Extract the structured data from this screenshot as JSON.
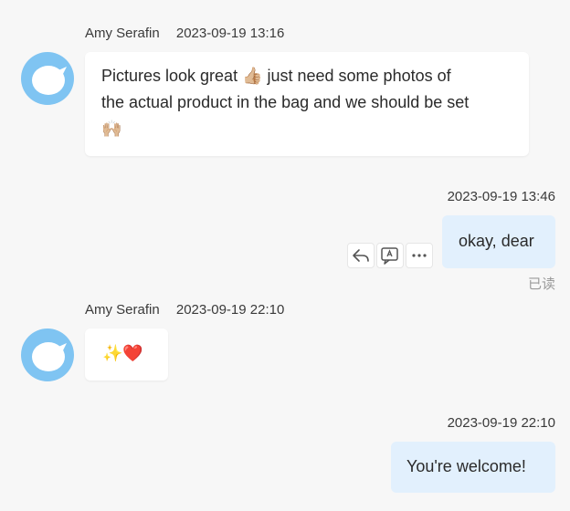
{
  "messages": [
    {
      "sender": "Amy Serafin",
      "time": "2023-09-19 13:16",
      "line1": "Pictures look great 👍🏼 just need some photos of",
      "line2": "the actual product in the bag and we should be set",
      "line3": "🙌🏼"
    },
    {
      "time": "2023-09-19 13:46",
      "text": "okay, dear",
      "status": "已读"
    },
    {
      "sender": "Amy Serafin",
      "time": "2023-09-19 22:10",
      "text": "✨❤️"
    },
    {
      "time": "2023-09-19 22:10",
      "text": "You're welcome!"
    }
  ],
  "icons": {
    "avatar": "chat-bubble-avatar-icon",
    "reply": "reply-icon",
    "translate": "translate-icon",
    "more": "more-icon"
  },
  "colors": {
    "background": "#f7f7f7",
    "incoming_bubble": "#ffffff",
    "outgoing_bubble": "#e2f0fd",
    "avatar": "#7fc4f2"
  }
}
